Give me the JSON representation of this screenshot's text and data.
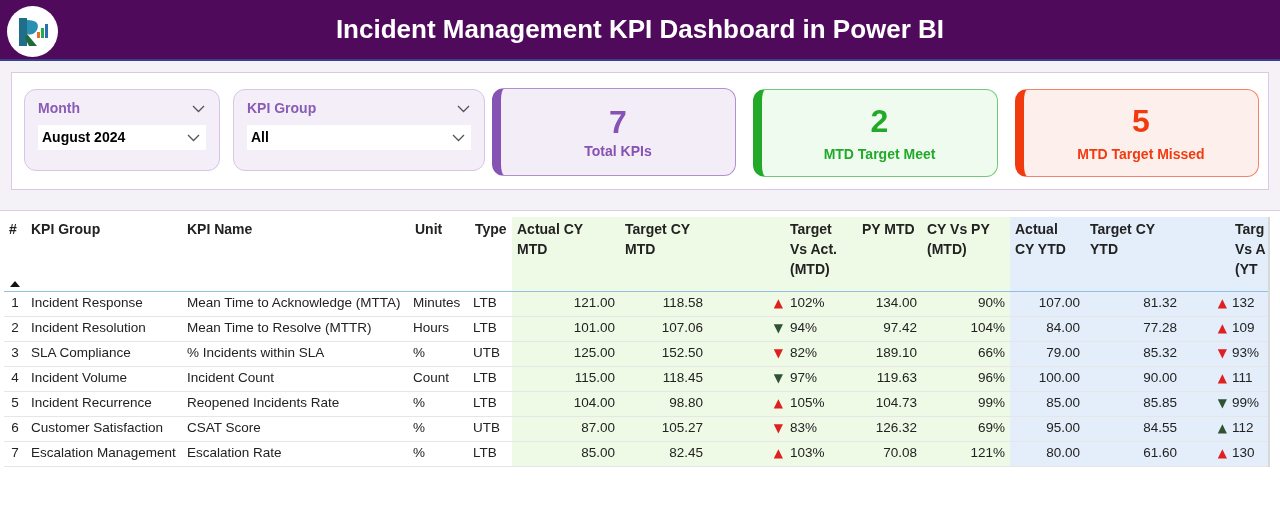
{
  "header": {
    "title": "Incident Management KPI Dashboard in Power BI"
  },
  "slicers": [
    {
      "label": "Month",
      "value": "August 2024"
    },
    {
      "label": "KPI Group",
      "value": "All"
    }
  ],
  "cards": [
    {
      "kind": "total",
      "value": "7",
      "label": "Total KPIs",
      "color": "#8652b3"
    },
    {
      "kind": "met",
      "value": "2",
      "label": "MTD Target Meet",
      "color": "#22a92a"
    },
    {
      "kind": "missed",
      "value": "5",
      "label": "MTD Target Missed",
      "color": "#f23a0f"
    }
  ],
  "table": {
    "columns": [
      "#",
      "KPI Group",
      "KPI Name",
      "Unit",
      "Type",
      "Actual CY MTD",
      "Target CY MTD",
      "Target Vs Act. (MTD)",
      "PY MTD",
      "CY Vs PY (MTD)",
      "Actual CY YTD",
      "Target CY YTD",
      "Targ Vs A (YT"
    ],
    "rows": [
      {
        "no": "1",
        "group": "Incident Response",
        "name": "Mean Time to Acknowledge (MTTA)",
        "unit": "Minutes",
        "type": "LTB",
        "actual_mtd": "121.00",
        "target_mtd": "118.58",
        "mtd_arrow": {
          "symbol": "▲",
          "color": "#e02020"
        },
        "mtd_pct": "102%",
        "py_mtd": "134.00",
        "cy_vs_py": "90%",
        "actual_ytd": "107.00",
        "target_ytd": "81.32",
        "ytd_arrow": {
          "symbol": "▲",
          "color": "#e02020"
        },
        "ytd_pct": "132"
      },
      {
        "no": "2",
        "group": "Incident Resolution",
        "name": "Mean Time to Resolve (MTTR)",
        "unit": "Hours",
        "type": "LTB",
        "actual_mtd": "101.00",
        "target_mtd": "107.06",
        "mtd_arrow": {
          "symbol": "▼",
          "color": "#2f5233"
        },
        "mtd_pct": "94%",
        "py_mtd": "97.42",
        "cy_vs_py": "104%",
        "actual_ytd": "84.00",
        "target_ytd": "77.28",
        "ytd_arrow": {
          "symbol": "▲",
          "color": "#e02020"
        },
        "ytd_pct": "109"
      },
      {
        "no": "3",
        "group": "SLA Compliance",
        "name": "% Incidents within SLA",
        "unit": "%",
        "type": "UTB",
        "actual_mtd": "125.00",
        "target_mtd": "152.50",
        "mtd_arrow": {
          "symbol": "▼",
          "color": "#e02020"
        },
        "mtd_pct": "82%",
        "py_mtd": "189.10",
        "cy_vs_py": "66%",
        "actual_ytd": "79.00",
        "target_ytd": "85.32",
        "ytd_arrow": {
          "symbol": "▼",
          "color": "#e02020"
        },
        "ytd_pct": "93%"
      },
      {
        "no": "4",
        "group": "Incident Volume",
        "name": "Incident Count",
        "unit": "Count",
        "type": "LTB",
        "actual_mtd": "115.00",
        "target_mtd": "118.45",
        "mtd_arrow": {
          "symbol": "▼",
          "color": "#2f5233"
        },
        "mtd_pct": "97%",
        "py_mtd": "119.63",
        "cy_vs_py": "96%",
        "actual_ytd": "100.00",
        "target_ytd": "90.00",
        "ytd_arrow": {
          "symbol": "▲",
          "color": "#e02020"
        },
        "ytd_pct": "111"
      },
      {
        "no": "5",
        "group": "Incident Recurrence",
        "name": "Reopened Incidents Rate",
        "unit": "%",
        "type": "LTB",
        "actual_mtd": "104.00",
        "target_mtd": "98.80",
        "mtd_arrow": {
          "symbol": "▲",
          "color": "#e02020"
        },
        "mtd_pct": "105%",
        "py_mtd": "104.73",
        "cy_vs_py": "99%",
        "actual_ytd": "85.00",
        "target_ytd": "85.85",
        "ytd_arrow": {
          "symbol": "▼",
          "color": "#2f5233"
        },
        "ytd_pct": "99%"
      },
      {
        "no": "6",
        "group": "Customer Satisfaction",
        "name": "CSAT Score",
        "unit": "%",
        "type": "UTB",
        "actual_mtd": "87.00",
        "target_mtd": "105.27",
        "mtd_arrow": {
          "symbol": "▼",
          "color": "#e02020"
        },
        "mtd_pct": "83%",
        "py_mtd": "126.32",
        "cy_vs_py": "69%",
        "actual_ytd": "95.00",
        "target_ytd": "84.55",
        "ytd_arrow": {
          "symbol": "▲",
          "color": "#2f5233"
        },
        "ytd_pct": "112"
      },
      {
        "no": "7",
        "group": "Escalation Management",
        "name": "Escalation Rate",
        "unit": "%",
        "type": "LTB",
        "actual_mtd": "85.00",
        "target_mtd": "82.45",
        "mtd_arrow": {
          "symbol": "▲",
          "color": "#e02020"
        },
        "mtd_pct": "103%",
        "py_mtd": "70.08",
        "cy_vs_py": "121%",
        "actual_ytd": "80.00",
        "target_ytd": "61.60",
        "ytd_arrow": {
          "symbol": "▲",
          "color": "#e02020"
        },
        "ytd_pct": "130"
      }
    ]
  }
}
